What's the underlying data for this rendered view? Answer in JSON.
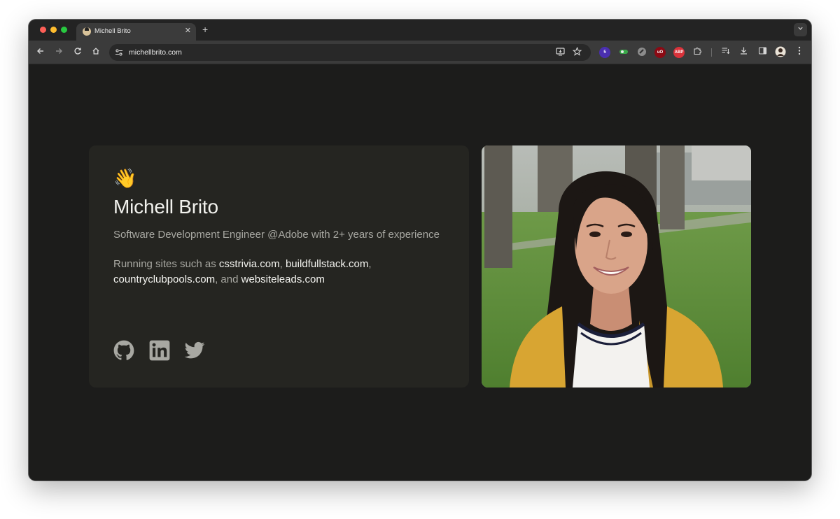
{
  "browser": {
    "tab_title": "Michell Brito",
    "tab_close": "✕",
    "new_tab": "+",
    "url": "michellbrito.com",
    "extensions": [
      {
        "name": "extension-badge",
        "badge": "5",
        "color": "#5b3fd6"
      },
      {
        "name": "extension-green",
        "label": "",
        "color": "#3aa84a"
      },
      {
        "name": "extension-dark",
        "label": "",
        "color": "#7a7a7a"
      },
      {
        "name": "ublock-origin",
        "label": "uO",
        "color": "#8b0a14"
      },
      {
        "name": "adblock-plus",
        "label": "ABP",
        "color": "#d9323a"
      }
    ]
  },
  "hero": {
    "emoji": "👋",
    "name": "Michell Brito",
    "role": "Software Development Engineer @Adobe with 2+ years of experience",
    "running_prefix": "Running sites such as ",
    "sites": [
      "csstrivia.com",
      "buildfullstack.com",
      "countryclubpools.com",
      "websiteleads.com"
    ],
    "sep_1": ", ",
    "sep_2": ",",
    "sep_3": ", and ",
    "socials": [
      "github",
      "linkedin",
      "twitter"
    ]
  },
  "colors": {
    "page_bg": "#1c1c1b",
    "card_bg": "#252521",
    "text_primary": "#f2f2ee",
    "text_muted": "#a8a8a2"
  }
}
